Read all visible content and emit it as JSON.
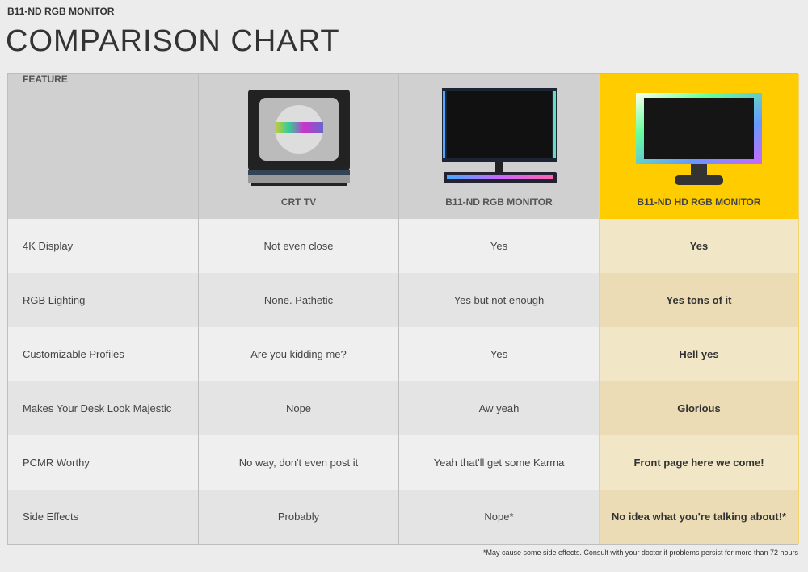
{
  "header": {
    "subtitle": "B11-ND RGB MONITOR",
    "title": "COMPARISON CHART"
  },
  "table": {
    "columns": [
      "FEATURE",
      "CRT TV",
      "B11-ND RGB MONITOR",
      "B11-ND HD RGB MONITOR"
    ],
    "highlight_color": "#ffcc00",
    "rows": [
      [
        "4K Display",
        "Not even close",
        "Yes",
        "Yes"
      ],
      [
        "RGB Lighting",
        "None. Pathetic",
        "Yes but not enough",
        "Yes tons of it"
      ],
      [
        "Customizable Profiles",
        "Are you kidding me?",
        "Yes",
        "Hell yes"
      ],
      [
        "Makes Your Desk Look Majestic",
        "Nope",
        "Aw yeah",
        "Glorious"
      ],
      [
        "PCMR Worthy",
        "No way, don't even post it",
        "Yeah that'll get some Karma",
        "Front page here we come!"
      ],
      [
        "Side Effects",
        "Probably",
        "Nope*",
        "No idea what you're talking about!*"
      ]
    ]
  },
  "footnote": "*May cause some side effects. Consult with your doctor if problems persist for more than 72 hours"
}
